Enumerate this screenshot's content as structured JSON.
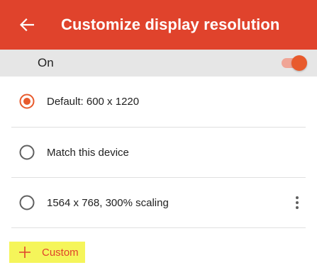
{
  "colors": {
    "appbar": "#e0432c",
    "accent": "#e85a2c",
    "master_bar": "#e6e6e6",
    "highlight": "#f5f55a"
  },
  "header": {
    "back_icon": "arrow-left-icon",
    "title": "Customize display resolution"
  },
  "master_switch": {
    "label": "On",
    "state": "on"
  },
  "options": [
    {
      "label": "Default: 600 x 1220",
      "selected": true
    },
    {
      "label": "Match this device",
      "selected": false
    },
    {
      "label": "1564 x 768, 300% scaling",
      "selected": false,
      "menu_icon": "more-vert-icon"
    }
  ],
  "add_custom": {
    "icon": "plus-icon",
    "label": "Custom"
  }
}
